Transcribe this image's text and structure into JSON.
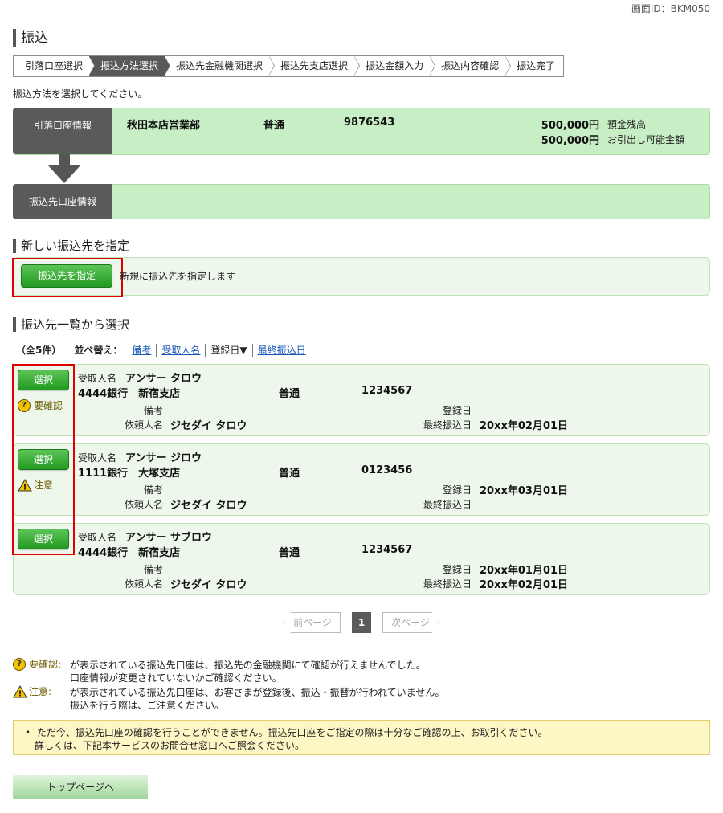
{
  "screen_id": "画面ID：BKM050",
  "page_title": "振込",
  "steps": [
    {
      "label": "引落口座選択",
      "active": false
    },
    {
      "label": "振込方法選択",
      "active": true
    },
    {
      "label": "振込先金融機関選択",
      "active": false
    },
    {
      "label": "振込先支店選択",
      "active": false
    },
    {
      "label": "振込金額入力",
      "active": false
    },
    {
      "label": "振込内容確認",
      "active": false
    },
    {
      "label": "振込完了",
      "active": false
    }
  ],
  "instruction": "振込方法を選択してください。",
  "source_account": {
    "tab_label": "引落口座情報",
    "branch": "秋田本店営業部",
    "type": "普通",
    "number": "9876543",
    "balance": "500,000円",
    "balance_label": "預金残高",
    "available": "500,000円",
    "available_label": "お引出し可能金額"
  },
  "dest_account": {
    "tab_label": "振込先口座情報"
  },
  "new_dest": {
    "heading": "新しい振込先を指定",
    "button": "振込先を指定",
    "description": "新規に振込先を指定します"
  },
  "list_section": {
    "heading": "振込先一覧から選択",
    "count": "（全5件）",
    "sort_label": "並べ替え：",
    "sort_options": [
      "備考",
      "受取人名",
      "登録日▼",
      "最終振込日"
    ],
    "label_recipient": "受取人名",
    "label_memo": "備考",
    "label_requester": "依頼人名",
    "label_registered": "登録日",
    "label_last": "最終振込日",
    "select_button": "選択"
  },
  "payees": [
    {
      "recipient": "アンサー タロウ",
      "bank_branch": "4444銀行　新宿支店",
      "type": "普通",
      "number": "1234567",
      "memo": "",
      "requester": "ジセダイ タロウ",
      "registered": "",
      "last": "20xx年02月01日",
      "badge": "要確認"
    },
    {
      "recipient": "アンサー ジロウ",
      "bank_branch": "1111銀行　大塚支店",
      "type": "普通",
      "number": "0123456",
      "memo": "",
      "requester": "ジセダイ タロウ",
      "registered": "20xx年03月01日",
      "last": "",
      "badge": "注意"
    },
    {
      "recipient": "アンサー サブロウ",
      "bank_branch": "4444銀行　新宿支店",
      "type": "普通",
      "number": "1234567",
      "memo": "",
      "requester": "ジセダイ タロウ",
      "registered": "20xx年01月01日",
      "last": "20xx年02月01日",
      "badge": ""
    }
  ],
  "pager": {
    "prev": "前ページ",
    "current": "1",
    "next": "次ページ"
  },
  "legend": {
    "confirm_label": "要確認:",
    "confirm_text_1": "が表示されている振込先口座は、振込先の金融機関にて確認が行えませんでした。",
    "confirm_text_2": "口座情報が変更されていないかご確認ください。",
    "caution_label": "注意:",
    "caution_text_1": "が表示されている振込先口座は、お客さまが登録後、振込・振替が行われていません。",
    "caution_text_2": "振込を行う際は、ご注意ください。"
  },
  "notice": {
    "line1": "ただ今、振込先口座の確認を行うことができません。振込先口座をご指定の際は十分なご確認の上、お取引ください。",
    "line2": "詳しくは、下記本サービスのお問合せ窓口へご照会ください。"
  },
  "top_button": "トップページへ",
  "colors": {
    "accent_green": "#239a21",
    "highlight_red": "#e00000",
    "panel_green": "#c8eec5",
    "step_active": "#595959"
  }
}
